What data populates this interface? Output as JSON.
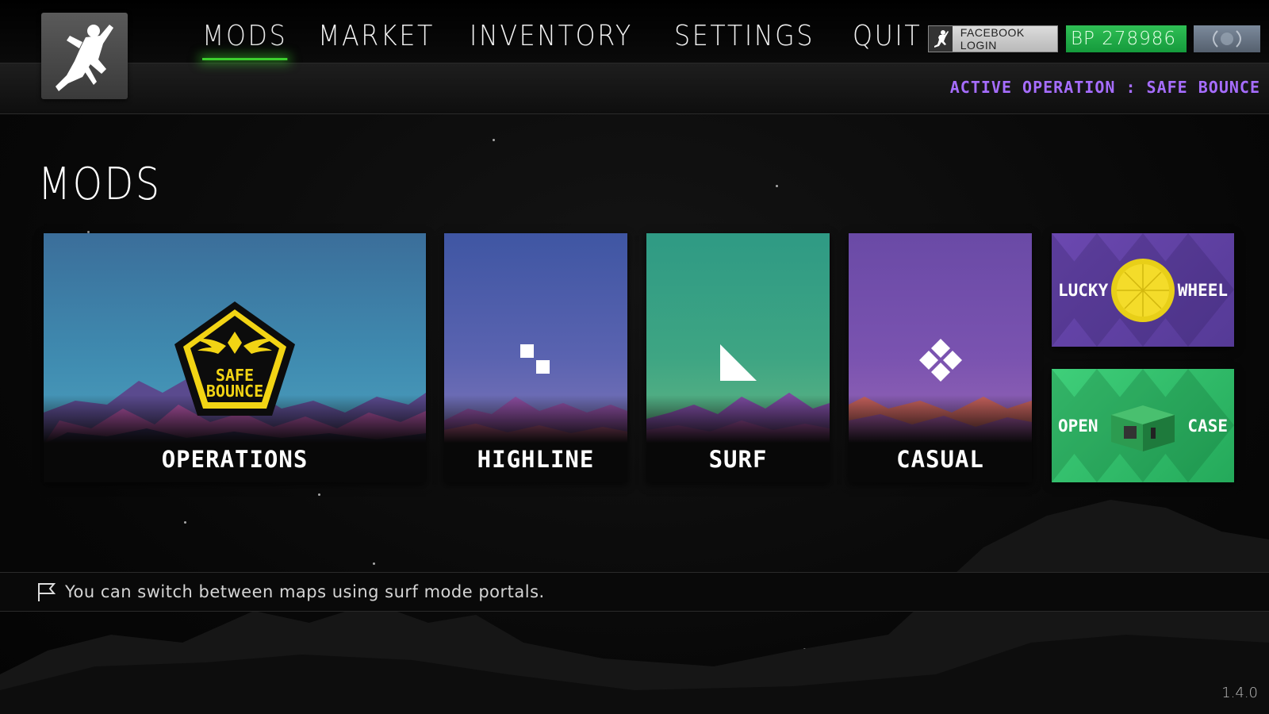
{
  "nav": {
    "items": [
      "MODS",
      "MARKET",
      "INVENTORY",
      "SETTINGS",
      "QUIT"
    ],
    "active_index": 0
  },
  "header": {
    "facebook_label": "FACEBOOK LOGIN",
    "bp_value": "BP 278986",
    "active_operation": "ACTIVE OPERATION : SAFE BOUNCE"
  },
  "page": {
    "title": "MODS"
  },
  "cards": {
    "operations": {
      "label": "OPERATIONS",
      "badge_text_1": "SAFE",
      "badge_text_2": "BOUNCE"
    },
    "highline": {
      "label": "HIGHLINE"
    },
    "surf": {
      "label": "SURF"
    },
    "casual": {
      "label": "CASUAL"
    }
  },
  "side_tiles": {
    "wheel": {
      "left": "LUCKY",
      "right": "WHEEL"
    },
    "case": {
      "left": "OPEN",
      "right": "CASE"
    }
  },
  "hint": {
    "text": "You can switch between maps using surf mode portals."
  },
  "version": "1.4.0",
  "colors": {
    "accent_green": "#3ccf2e",
    "bp_green": "#1fae48",
    "operation_purple": "#a66dff",
    "badge_yellow": "#f2d414"
  },
  "icons": {
    "logo": "parkour-jumper-icon",
    "facebook": "jumper-small-icon",
    "rank": "rank-emblem-icon",
    "hint": "flag-icon"
  }
}
